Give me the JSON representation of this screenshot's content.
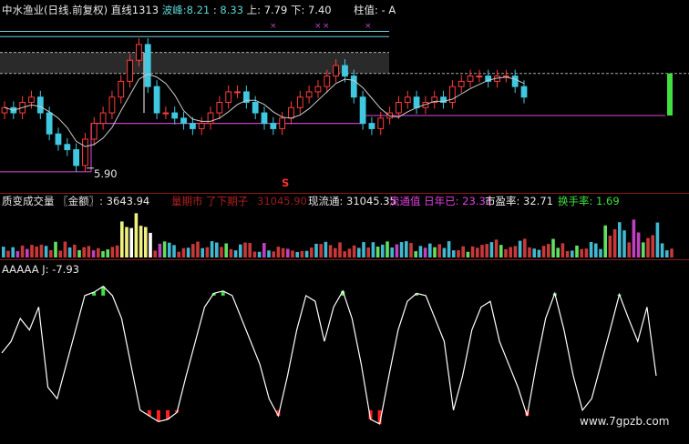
{
  "header": {
    "stock_title": "中水渔业(日线.前复权)",
    "line_label": "直线1313",
    "wave_label": "波峰:",
    "wave_v1": "8.21",
    "wave_sep": ":",
    "wave_v2": "8.33",
    "up_label": "上: 7.79",
    "down_label": "下: 7.40",
    "pillar_label": "柱值: - A"
  },
  "price_labels": {
    "low_marker": "5.90",
    "s_marker": "S"
  },
  "volume": {
    "title": "质变成交量",
    "amount_label": "〖金额〗: 3643.94",
    "obscured_1": "量期市 了下期子",
    "obscured_2": "31045.90",
    "obscured_3": "现流通: 31045.35",
    "obscured_4": "流通值 日年已: 23.31",
    "obscured_5": "市盈率: 32.71",
    "turnover": "换手率: 1.69"
  },
  "kdj": {
    "title": "AAAAA  J: -7.93"
  },
  "watermark": "www.7gpzb.com",
  "colors": {
    "up": "#ff3c3c",
    "down": "#40c8e0",
    "white_line": "#ffffff",
    "magenta": "#c040c0",
    "green_bar": "#40e040",
    "red_bar": "#ff2020"
  },
  "chart_data": [
    {
      "type": "line",
      "name": "price-candles",
      "x": [
        0,
        10,
        20,
        30,
        40,
        50,
        60,
        70,
        80,
        90,
        100,
        110,
        120,
        130,
        140,
        150,
        160,
        170,
        180,
        190,
        200,
        210,
        220,
        230,
        240,
        250,
        260,
        270,
        280,
        290,
        300,
        310,
        320,
        330,
        340,
        350,
        360,
        370,
        380,
        390,
        400,
        410,
        420,
        430,
        440,
        450,
        460,
        470,
        480,
        490,
        500,
        510,
        520,
        530,
        540,
        550,
        560,
        570,
        580
      ],
      "values": [
        7.1,
        7.0,
        7.2,
        7.3,
        7.0,
        6.6,
        6.4,
        6.3,
        6.0,
        6.5,
        6.8,
        7.0,
        7.3,
        7.6,
        8.0,
        8.3,
        7.5,
        7.0,
        7.0,
        6.9,
        6.8,
        6.7,
        6.8,
        7.0,
        7.2,
        7.4,
        7.4,
        7.2,
        7.0,
        6.8,
        6.7,
        6.9,
        7.1,
        7.3,
        7.4,
        7.5,
        7.7,
        7.9,
        7.7,
        7.3,
        6.8,
        6.7,
        6.9,
        7.0,
        7.2,
        7.3,
        7.1,
        7.2,
        7.3,
        7.2,
        7.5,
        7.6,
        7.7,
        7.7,
        7.6,
        7.7,
        7.7,
        7.5,
        7.3
      ],
      "ylim": [
        5.6,
        8.8
      ]
    },
    {
      "type": "bar",
      "name": "kdj-j",
      "x": [
        0,
        10,
        20,
        30,
        40,
        50,
        60,
        70,
        80,
        90,
        100,
        110,
        120,
        130,
        140,
        150,
        160,
        170,
        180,
        190,
        200,
        210,
        220,
        230,
        240,
        250,
        260,
        270,
        280,
        290,
        300,
        310,
        320,
        330,
        340,
        350,
        360,
        370,
        380,
        390,
        400,
        410,
        420,
        430,
        440,
        450,
        460,
        470,
        480,
        490,
        500,
        510,
        520,
        530,
        540,
        550,
        560,
        570,
        580,
        590,
        600,
        610,
        620,
        630,
        640,
        650,
        660,
        670,
        680,
        690,
        700,
        710
      ],
      "values": [
        50,
        60,
        80,
        70,
        90,
        20,
        10,
        40,
        70,
        100,
        103,
        108,
        100,
        80,
        40,
        0,
        -5,
        -10,
        -8,
        -2,
        30,
        60,
        90,
        102,
        104,
        100,
        80,
        60,
        40,
        10,
        -5,
        30,
        70,
        100,
        95,
        60,
        90,
        104,
        80,
        40,
        -8,
        -12,
        30,
        70,
        95,
        102,
        100,
        80,
        60,
        0,
        30,
        70,
        90,
        95,
        60,
        40,
        20,
        -5,
        40,
        80,
        102,
        70,
        30,
        0,
        10,
        40,
        70,
        101,
        80,
        60,
        90,
        30
      ],
      "ylim": [
        -20,
        115
      ]
    }
  ]
}
